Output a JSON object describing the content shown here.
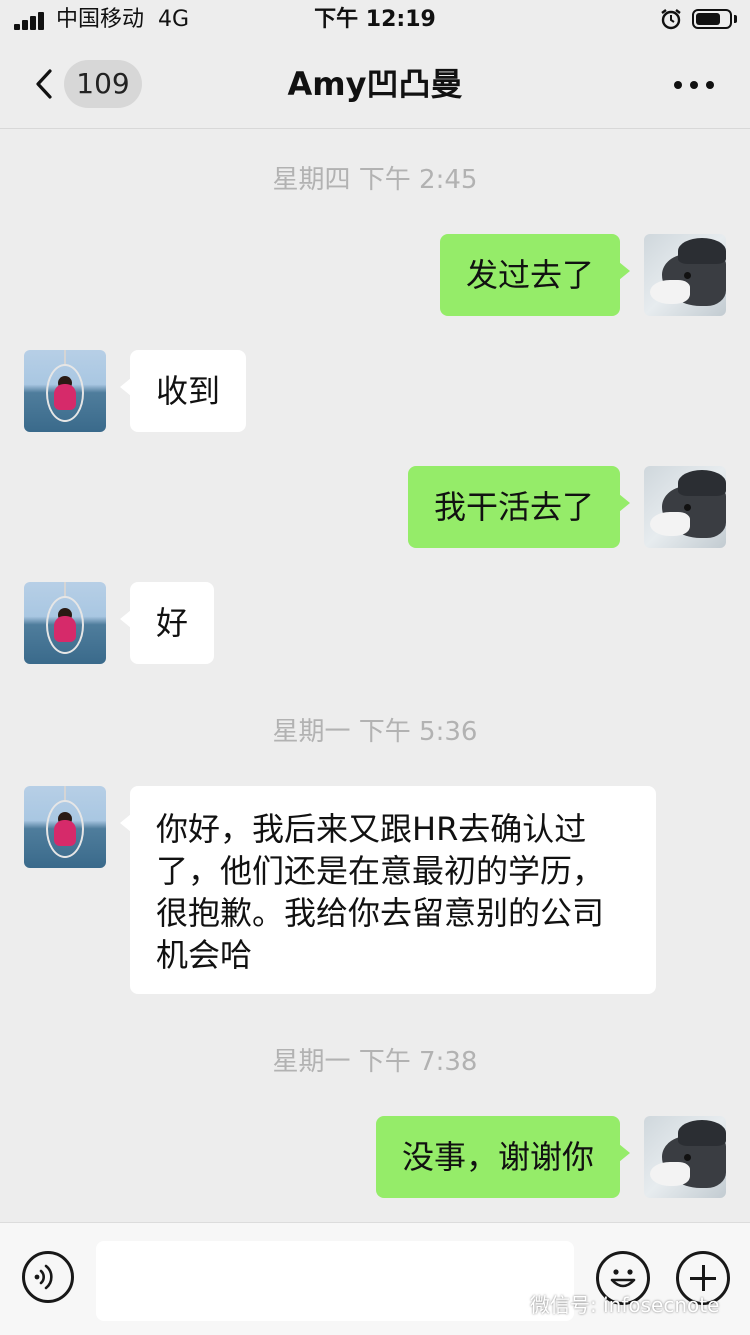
{
  "status_bar": {
    "carrier": "中国移动",
    "network": "4G",
    "time": "下午 12:19",
    "battery_level": 0.75,
    "icons": [
      "signal-bars-icon",
      "alarm-clock-icon",
      "battery-icon"
    ]
  },
  "nav": {
    "back_icon": "chevron-left-icon",
    "unread_count": "109",
    "title": "Amy凹凸曼",
    "more_icon": "more-dots-icon"
  },
  "messages": [
    {
      "type": "timestamp",
      "text": "星期四 下午 2:45"
    },
    {
      "type": "message",
      "direction": "outgoing",
      "text": "发过去了"
    },
    {
      "type": "message",
      "direction": "incoming",
      "text": "收到"
    },
    {
      "type": "message",
      "direction": "outgoing",
      "text": "我干活去了"
    },
    {
      "type": "message",
      "direction": "incoming",
      "text": "好"
    },
    {
      "type": "timestamp",
      "text": "星期一 下午 5:36"
    },
    {
      "type": "message",
      "direction": "incoming",
      "text": "你好，我后来又跟HR去确认过了，他们还是在意最初的学历，很抱歉。我给你去留意别的公司机会哈"
    },
    {
      "type": "timestamp",
      "text": "星期一 下午 7:38"
    },
    {
      "type": "message",
      "direction": "outgoing",
      "text": "没事，谢谢你"
    }
  ],
  "input_bar": {
    "voice_icon": "voice-icon",
    "input_value": "",
    "emoji_icon": "emoji-icon",
    "plus_icon": "plus-icon"
  },
  "watermark": "微信号: infosecnote"
}
